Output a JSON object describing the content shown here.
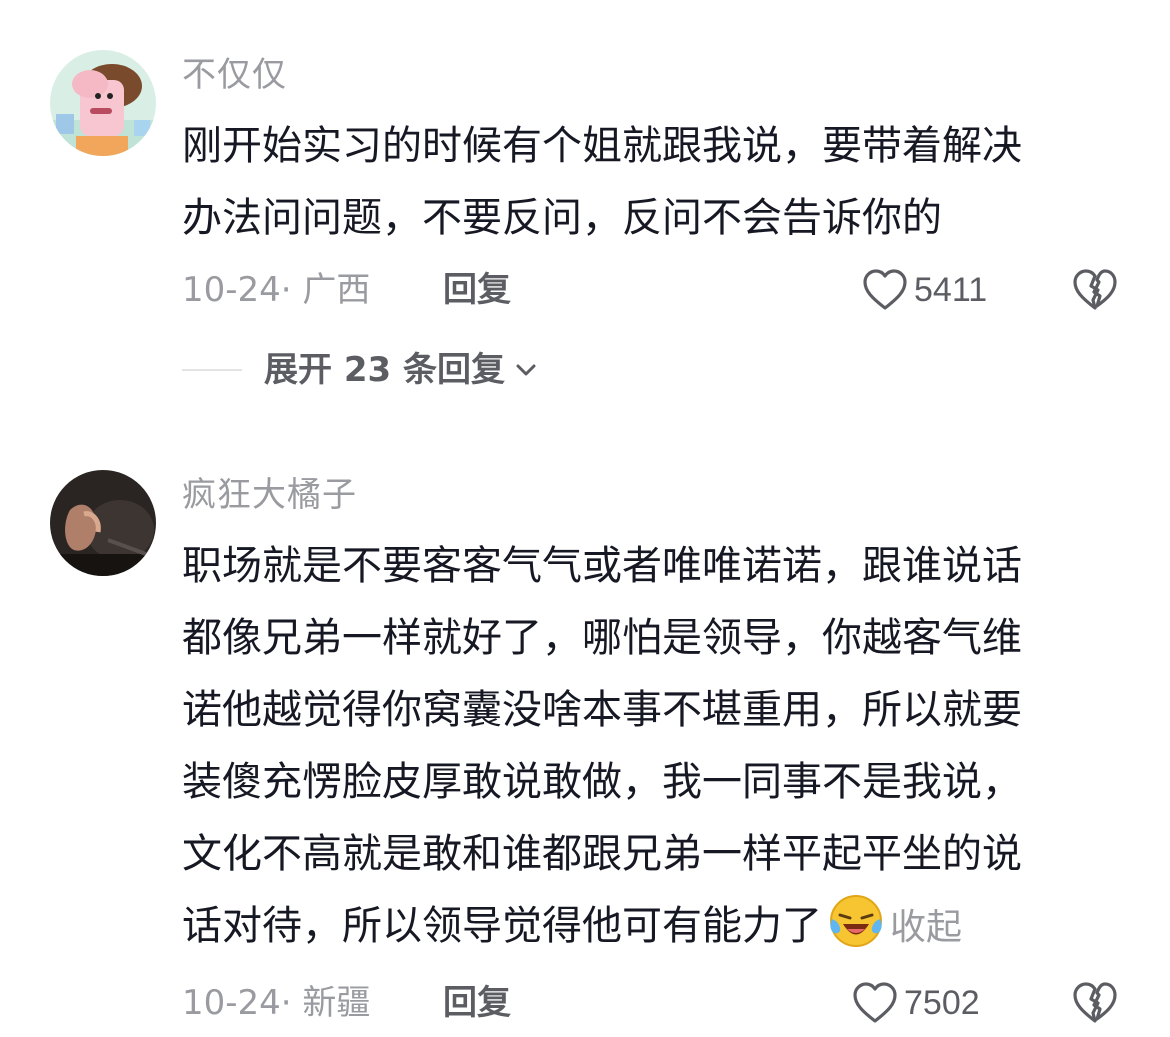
{
  "comments": [
    {
      "username": "不仅仅",
      "text_lines": [
        "刚开始实习的时候有个姐就跟我说，要带着解决",
        "办法问问题，不要反问，反问不会告诉你的"
      ],
      "date": "10-24",
      "location": "· 广西",
      "reply_label": "回复",
      "likes": "5411",
      "expand_label": "展开 23 条回复"
    },
    {
      "username": "疯狂大橘子",
      "text_lines": [
        "职场就是不要客客气气或者唯唯诺诺，跟谁说话",
        "都像兄弟一样就好了，哪怕是领导，你越客气维",
        "诺他越觉得你窝囊没啥本事不堪重用，所以就要",
        "装傻充愣脸皮厚敢说敢做，我一同事不是我说，",
        "文化不高就是敢和谁都跟兄弟一样平起平坐的说",
        "话对待，所以领导觉得他可有能力了"
      ],
      "collapse_label": "收起",
      "date": "10-24",
      "location": "· 新疆",
      "reply_label": "回复",
      "likes": "7502"
    }
  ],
  "icons": {
    "like": "heart-outline-icon",
    "dislike": "broken-heart-icon",
    "expand": "chevron-down-icon",
    "emoji": "laughing-crying-emoji"
  },
  "colors": {
    "text": "#161823",
    "secondary": "#9a9ba0",
    "action": "#5c5d63"
  }
}
